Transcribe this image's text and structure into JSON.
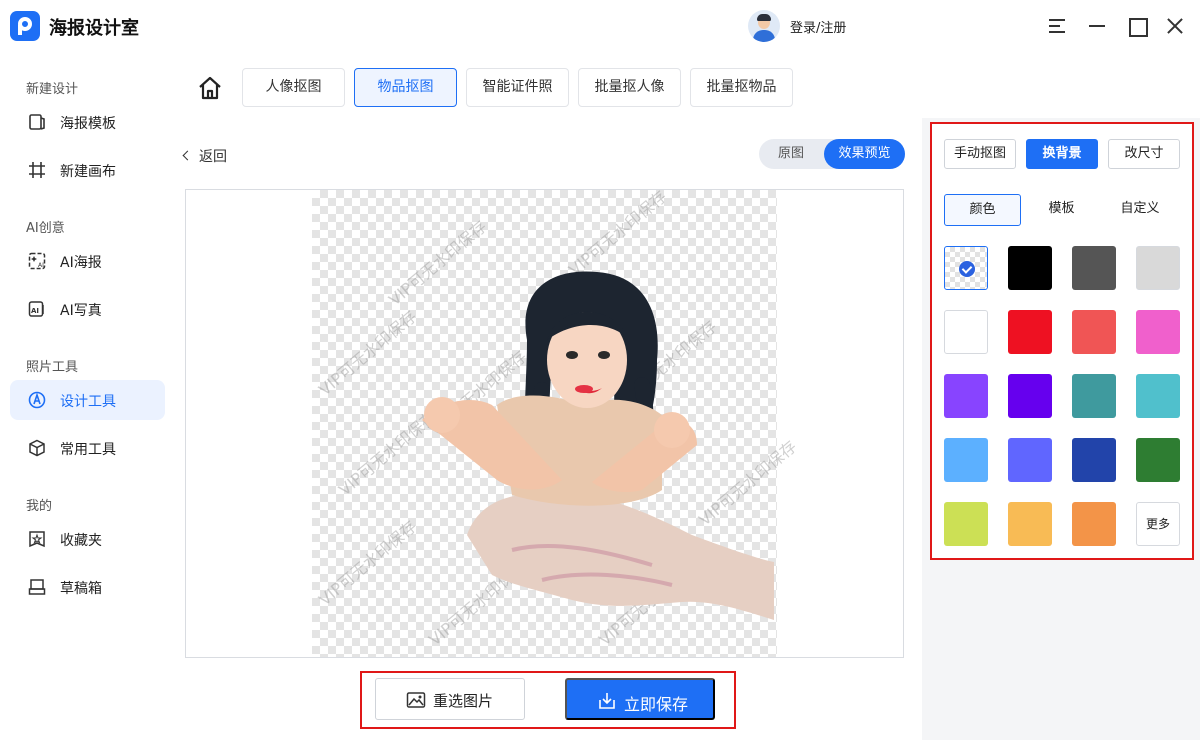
{
  "app": {
    "title": "海报设计室",
    "login": "登录/注册"
  },
  "sidebar": {
    "sections": [
      "新建设计",
      "AI创意",
      "照片工具",
      "我的"
    ],
    "items": [
      {
        "label": "海报模板",
        "icon": "poster-template-icon"
      },
      {
        "label": "新建画布",
        "icon": "hash-canvas-icon"
      },
      {
        "label": "AI海报",
        "icon": "ai-poster-icon"
      },
      {
        "label": "AI写真",
        "icon": "ai-portrait-icon"
      },
      {
        "label": "设计工具",
        "icon": "design-tool-icon",
        "active": true
      },
      {
        "label": "常用工具",
        "icon": "cube-icon"
      },
      {
        "label": "收藏夹",
        "icon": "star-folder-icon"
      },
      {
        "label": "草稿箱",
        "icon": "draft-box-icon"
      }
    ]
  },
  "tabs": [
    "人像抠图",
    "物品抠图",
    "智能证件照",
    "批量抠人像",
    "批量抠物品"
  ],
  "active_tab": "物品抠图",
  "main": {
    "back": "返回",
    "view_original": "原图",
    "view_preview": "效果预览",
    "watermark": "VIP可无水印保存"
  },
  "actions": {
    "reselect": "重选图片",
    "save": "立即保存"
  },
  "right": {
    "modes": [
      "手动抠图",
      "换背景",
      "改尺寸"
    ],
    "active_mode": "换背景",
    "subtabs": [
      "颜色",
      "模板",
      "自定义"
    ],
    "active_subtab": "颜色",
    "colors": [
      "transparent",
      "#000000",
      "#555555",
      "#d9d9d9",
      "#ffffff",
      "#ee1122",
      "#f05555",
      "#f060cc",
      "#8844ff",
      "#6600ee",
      "#3f9a9e",
      "#50c0cc",
      "#5cb0ff",
      "#6066ff",
      "#2244aa",
      "#2e7d32",
      "#cce055",
      "#f8bb55",
      "#f39448"
    ],
    "more": "更多"
  },
  "accent": "#1e6ff5"
}
